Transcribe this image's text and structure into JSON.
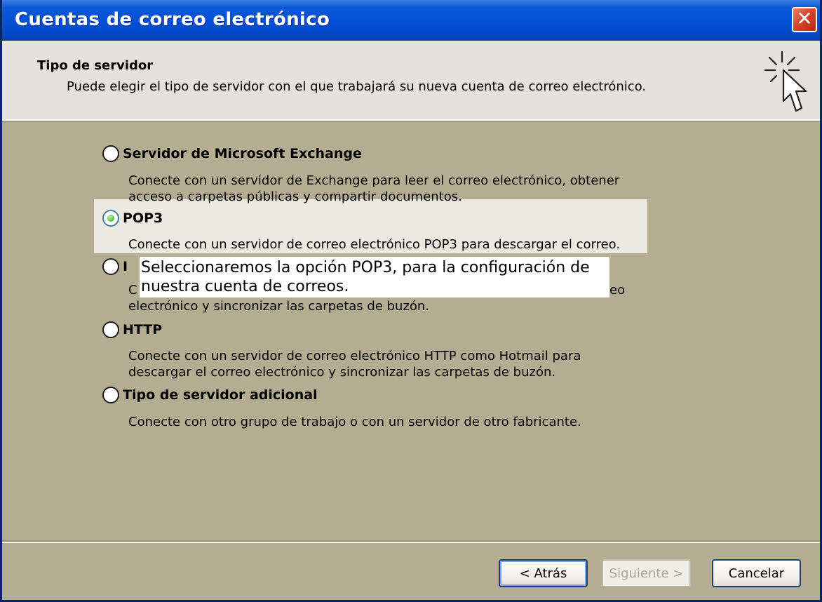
{
  "window": {
    "title": "Cuentas de correo electrónico",
    "close_glyph": "✕"
  },
  "header": {
    "title": "Tipo de servidor",
    "subtitle": "Puede elegir el tipo de servidor con el que trabajará su nueva cuenta de correo electrónico.",
    "icon": "wizard-cursor-icon"
  },
  "options": [
    {
      "label": "Servidor de Microsoft Exchange",
      "description_line1": "Conecte con un servidor de Exchange para leer el correo electrónico, obtener",
      "description_line2": "acceso a carpetas públicas y compartir documentos.",
      "checked": false
    },
    {
      "label": "POP3",
      "description_line1": "Conecte con un servidor de correo electrónico POP3 para descargar el correo.",
      "checked": true
    },
    {
      "label": "I",
      "description_line1_start": "C",
      "description_line1_end": "eo",
      "description_line2": "electrónico y sincronizar las carpetas de buzón.",
      "checked": false
    },
    {
      "label": "HTTP",
      "description_line1": "Conecte con un servidor de correo electrónico HTTP como Hotmail para",
      "description_line2": "descargar el correo electrónico y sincronizar las carpetas de buzón.",
      "checked": false
    },
    {
      "label": "Tipo de servidor adicional",
      "description_line1": "Conecte con otro grupo de trabajo o con un servidor de otro fabricante.",
      "checked": false
    }
  ],
  "annotation": {
    "line1": "Seleccionaremos la opción POP3, para la configuración de",
    "line2": "nuestra cuenta de correos."
  },
  "buttons": {
    "back": "< Atrás",
    "next": "Siguiente >",
    "cancel": "Cancelar"
  },
  "colors": {
    "titlebar": "#0450d6",
    "body": "#b5ad92",
    "header": "#e4e2dd",
    "highlight": "#ece9e0",
    "radio_checked": "#28a824"
  }
}
